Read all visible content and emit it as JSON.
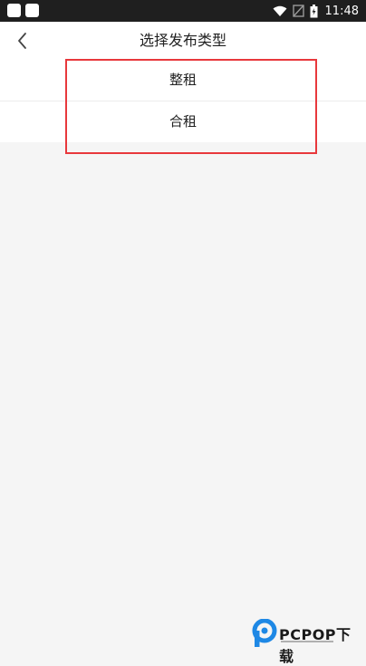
{
  "status_bar": {
    "time": "11:48",
    "icons": [
      "wifi-icon",
      "signal-off-icon",
      "battery-icon"
    ]
  },
  "header": {
    "title": "选择发布类型",
    "back_icon": "chevron-left-icon"
  },
  "options": [
    {
      "label": "整租"
    },
    {
      "label": "合租"
    }
  ],
  "colors": {
    "status_bar_bg": "#1f1f1f",
    "page_bg": "#f5f5f5",
    "highlight": "#e8383c",
    "watermark_blue": "#1e88e5"
  },
  "watermark": {
    "brand": "PCPOP下载"
  }
}
